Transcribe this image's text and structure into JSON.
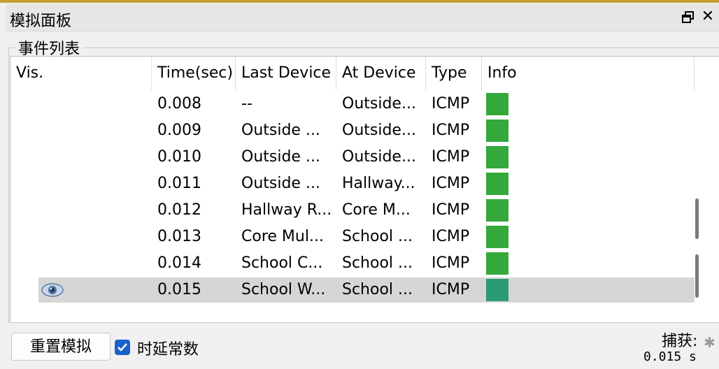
{
  "panel": {
    "title": "模拟面板",
    "restore_icon": "restore-window-icon",
    "close_label": "✕"
  },
  "event_list": {
    "group_label": "事件列表",
    "columns": [
      "Vis.",
      "Time(sec)",
      "Last Device",
      "At Device",
      "Type",
      "Info"
    ],
    "rows": [
      {
        "vis": "",
        "time": "0.008",
        "last_device": "--",
        "at_device": "Outside...",
        "type": "ICMP",
        "info_color": "#34a83a"
      },
      {
        "vis": "",
        "time": "0.009",
        "last_device": "Outside ...",
        "at_device": "Outside...",
        "type": "ICMP",
        "info_color": "#34a83a"
      },
      {
        "vis": "",
        "time": "0.010",
        "last_device": "Outside ...",
        "at_device": "Outside...",
        "type": "ICMP",
        "info_color": "#34a83a"
      },
      {
        "vis": "",
        "time": "0.011",
        "last_device": "Outside ...",
        "at_device": "Hallway...",
        "type": "ICMP",
        "info_color": "#34a83a"
      },
      {
        "vis": "",
        "time": "0.012",
        "last_device": "Hallway R...",
        "at_device": "Core M...",
        "type": "ICMP",
        "info_color": "#34a83a"
      },
      {
        "vis": "",
        "time": "0.013",
        "last_device": "Core Mul...",
        "at_device": "School ...",
        "type": "ICMP",
        "info_color": "#34a83a"
      },
      {
        "vis": "",
        "time": "0.014",
        "last_device": "School C...",
        "at_device": "School ...",
        "type": "ICMP",
        "info_color": "#34a83a"
      },
      {
        "vis": "eye-icon",
        "time": "0.015",
        "last_device": "School W...",
        "at_device": "School ...",
        "type": "ICMP",
        "info_color": "#2b9b74",
        "selected": true
      }
    ]
  },
  "controls": {
    "reset_button": "重置模拟",
    "delay_checkbox_label": "时延常数",
    "delay_checked": true,
    "capture_label": "捕获:",
    "capture_value": "0.015 s"
  }
}
